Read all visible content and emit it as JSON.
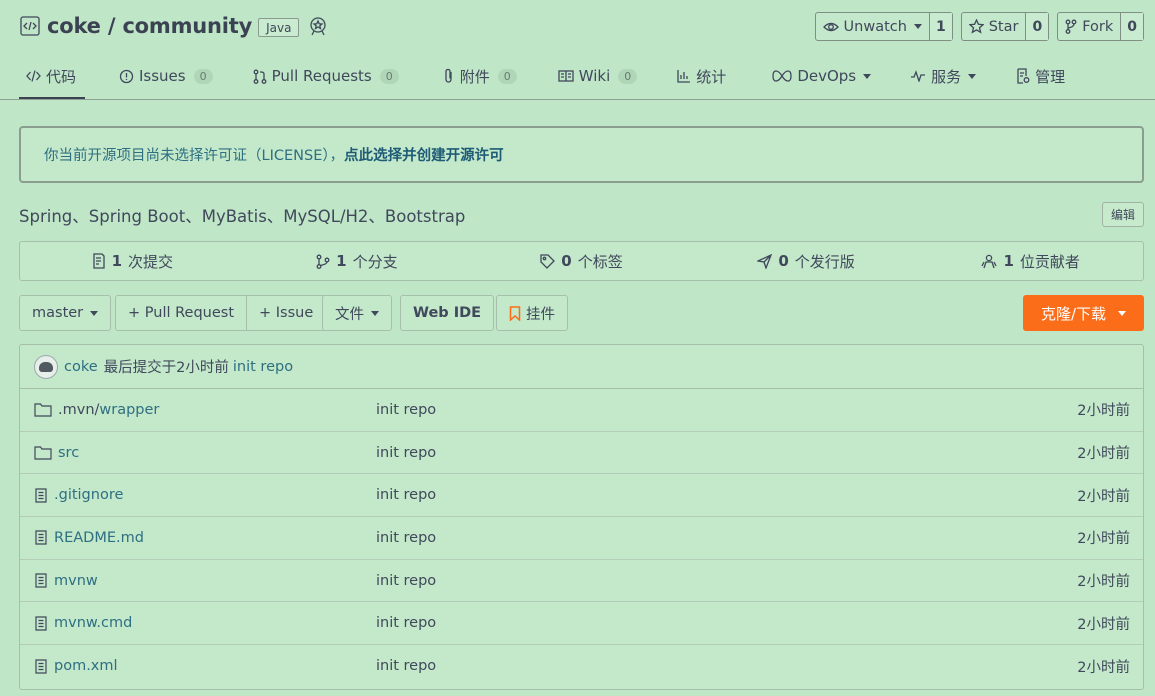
{
  "repo": {
    "owner": "coke",
    "separator": " / ",
    "name": "community",
    "language": "Java"
  },
  "actions": [
    {
      "label": "Unwatch",
      "count": "1",
      "icon": "eye-icon",
      "dropdown": true
    },
    {
      "label": "Star",
      "count": "0",
      "icon": "star-icon",
      "dropdown": false
    },
    {
      "label": "Fork",
      "count": "0",
      "icon": "fork-icon",
      "dropdown": false
    }
  ],
  "nav": [
    {
      "label": "代码",
      "icon": "code-icon",
      "badge": null
    },
    {
      "label": "Issues",
      "icon": "issue-icon",
      "badge": "0"
    },
    {
      "label": "Pull Requests",
      "icon": "pull-request-icon",
      "badge": "0"
    },
    {
      "label": "附件",
      "icon": "attachment-icon",
      "badge": "0"
    },
    {
      "label": "Wiki",
      "icon": "wiki-icon",
      "badge": "0"
    },
    {
      "label": "统计",
      "icon": "stats-icon",
      "badge": null
    },
    {
      "label": "DevOps",
      "icon": "devops-icon",
      "badge": null
    },
    {
      "label": "服务",
      "icon": "service-icon",
      "badge": null
    },
    {
      "label": "管理",
      "icon": "settings-doc-icon",
      "badge": null
    }
  ],
  "notice": {
    "text": "你当前开源项目尚未选择许可证（LICENSE），",
    "link": "点此选择并创建开源许可"
  },
  "description": "Spring、Spring Boot、MyBatis、MySQL/H2、Bootstrap",
  "edit_label": "编辑",
  "stats": [
    {
      "num": "1",
      "label": "次提交",
      "icon": "commit-icon"
    },
    {
      "num": "1",
      "label": "个分支",
      "icon": "branch-icon"
    },
    {
      "num": "0",
      "label": "个标签",
      "icon": "tag-icon"
    },
    {
      "num": "0",
      "label": "个发行版",
      "icon": "release-icon"
    },
    {
      "num": "1",
      "label": "位贡献者",
      "icon": "contributors-icon"
    }
  ],
  "toolbar": {
    "branch": "master",
    "pull_request": "+ Pull Request",
    "issue": "+ Issue",
    "file": "文件",
    "web_ide": "Web IDE",
    "widget": "挂件",
    "clone": "克隆/下载"
  },
  "last_commit": {
    "user": "coke",
    "text": "最后提交于",
    "time": "2小时前",
    "message": "init repo"
  },
  "files": [
    {
      "type": "folder",
      "prefix": ".mvn/",
      "name": "wrapper",
      "message": "init repo",
      "time": "2小时前"
    },
    {
      "type": "folder",
      "prefix": "",
      "name": "src",
      "message": "init repo",
      "time": "2小时前"
    },
    {
      "type": "file",
      "prefix": "",
      "name": ".gitignore",
      "message": "init repo",
      "time": "2小时前"
    },
    {
      "type": "file",
      "prefix": "",
      "name": "README.md",
      "message": "init repo",
      "time": "2小时前"
    },
    {
      "type": "file",
      "prefix": "",
      "name": "mvnw",
      "message": "init repo",
      "time": "2小时前"
    },
    {
      "type": "file",
      "prefix": "",
      "name": "mvnw.cmd",
      "message": "init repo",
      "time": "2小时前"
    },
    {
      "type": "file",
      "prefix": "",
      "name": "pom.xml",
      "message": "init repo",
      "time": "2小时前"
    }
  ],
  "colors": {
    "background": "#c0e6c8",
    "accent": "#fc6d19",
    "link": "#2f6f82"
  }
}
